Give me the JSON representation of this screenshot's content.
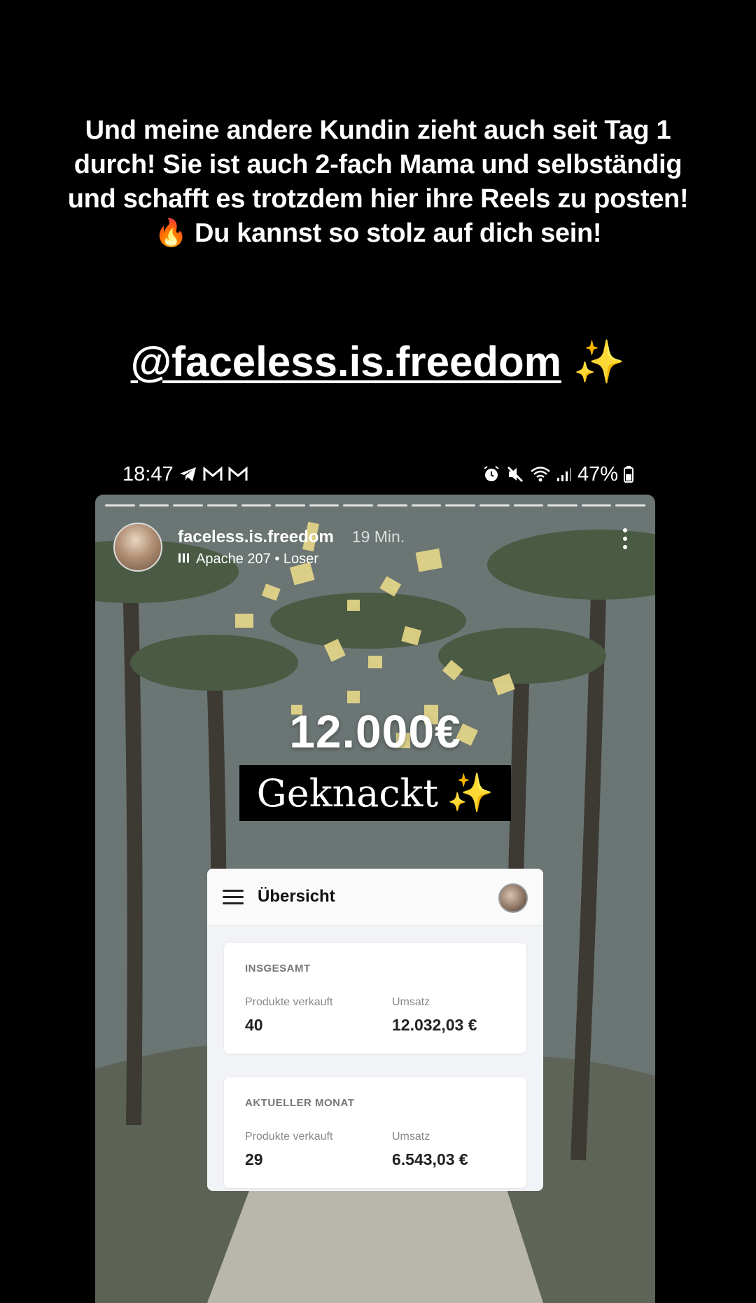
{
  "caption": {
    "line1": "Und meine andere Kundin zieht auch seit Tag 1",
    "line2": "durch! Sie ist auch 2-fach Mama und selbständig",
    "line3": "und schafft es trotzdem hier ihre Reels zu posten!",
    "line4_emoji": "🔥",
    "line4": "Du kannst so stolz auf dich sein!"
  },
  "mention": {
    "handle": "@faceless.is.freedom",
    "emoji": "✨"
  },
  "statusbar": {
    "time": "18:47",
    "battery": "47%"
  },
  "story": {
    "username": "faceless.is.freedom",
    "time_ago": "19 Min.",
    "music": "Apache 207 • Loser",
    "amount": "12.000€",
    "headline": "Geknackt",
    "headline_emoji": "✨"
  },
  "dashboard": {
    "title": "Übersicht",
    "total": {
      "label": "INSGESAMT",
      "sold_label": "Produkte verkauft",
      "sold_value": "40",
      "revenue_label": "Umsatz",
      "revenue_value": "12.032,03 €"
    },
    "month": {
      "label": "AKTUELLER MONAT",
      "sold_label": "Produkte verkauft",
      "sold_value": "29",
      "revenue_label": "Umsatz",
      "revenue_value": "6.543,03 €"
    }
  },
  "colors": {
    "background": "#000000",
    "confetti": "#e8d98a"
  }
}
